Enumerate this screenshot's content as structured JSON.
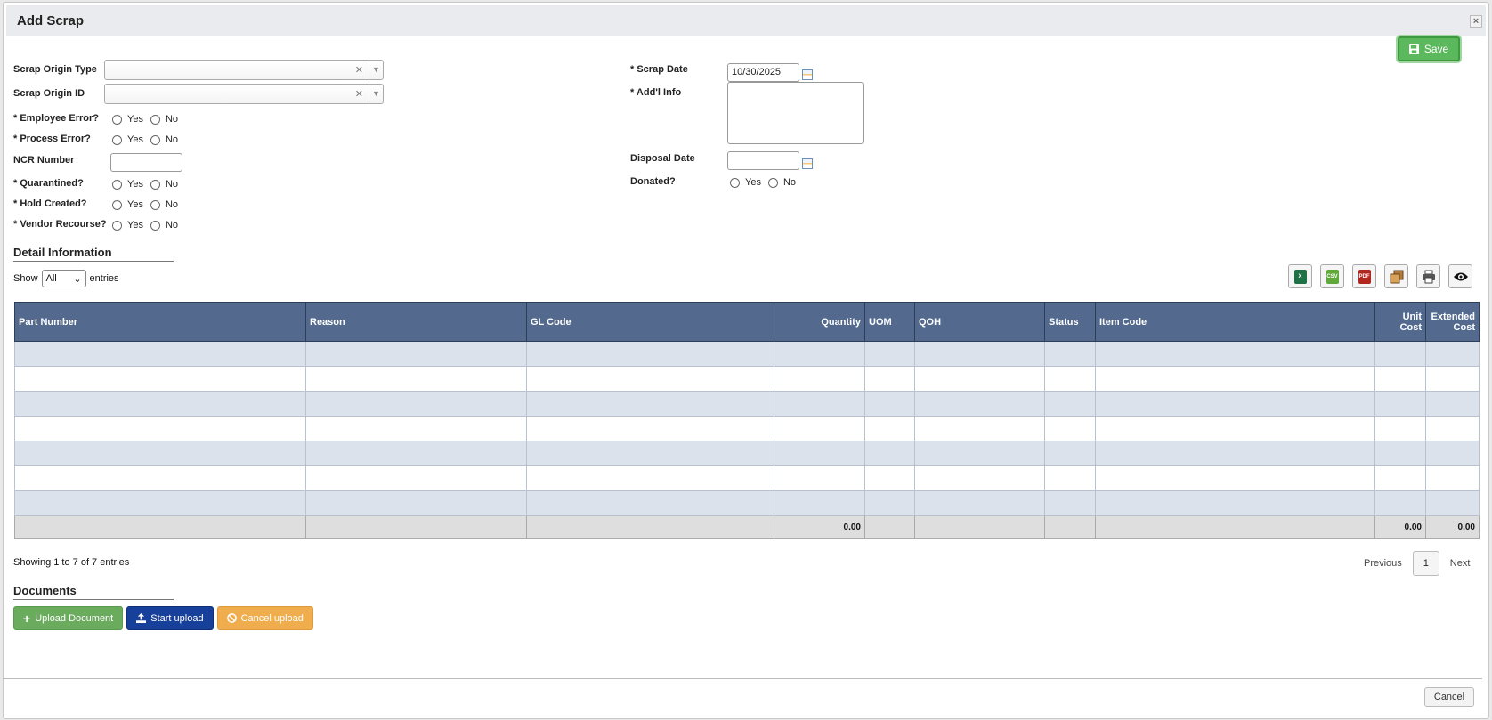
{
  "dialog": {
    "title": "Add Scrap",
    "save_label": "Save",
    "cancel_label": "Cancel"
  },
  "form_left": {
    "scrap_origin_type": "Scrap Origin Type",
    "scrap_origin_id": "Scrap Origin ID",
    "employee_error": "* Employee Error?",
    "process_error": "* Process Error?",
    "ncr_number": "NCR Number",
    "quarantined": "* Quarantined?",
    "hold_created": "* Hold Created?",
    "vendor_recourse": "* Vendor Recourse?"
  },
  "form_right": {
    "scrap_date_label": "* Scrap Date",
    "scrap_date_value": "10/30/2025",
    "addl_info_label": "* Add'l Info",
    "disposal_date_label": "Disposal Date",
    "donated_label": "Donated?"
  },
  "radio": {
    "yes": "Yes",
    "no": "No"
  },
  "detail": {
    "section_title": "Detail Information",
    "show_label": "Show",
    "show_value": "All",
    "entries_label": "entries",
    "columns": [
      "Part Number",
      "Reason",
      "GL Code",
      "Quantity",
      "UOM",
      "QOH",
      "Status",
      "Item Code",
      "Unit Cost",
      "Extended Cost"
    ],
    "totals": {
      "quantity": "0.00",
      "unit_cost": "0.00",
      "extended_cost": "0.00"
    },
    "info": "Showing 1 to 7 of 7 entries",
    "pager": {
      "previous": "Previous",
      "current": "1",
      "next": "Next"
    }
  },
  "documents": {
    "section_title": "Documents",
    "upload_label": "Upload Document",
    "start_label": "Start upload",
    "cancel_label": "Cancel upload"
  },
  "colors": {
    "header": "#536a8e",
    "save": "#5cb85c",
    "upload": "#6aab5e",
    "start": "#17409a",
    "cancel": "#f0ad4e"
  }
}
